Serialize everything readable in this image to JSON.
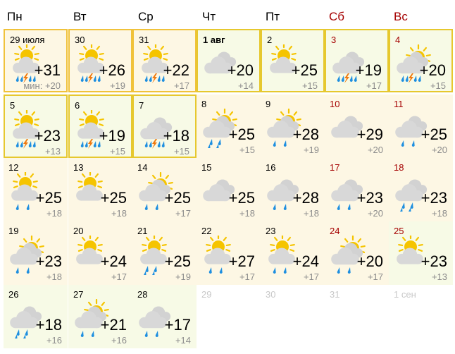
{
  "weekdays": [
    {
      "label": "Пн",
      "weekend": false
    },
    {
      "label": "Вт",
      "weekend": false
    },
    {
      "label": "Ср",
      "weekend": false
    },
    {
      "label": "Чт",
      "weekend": false
    },
    {
      "label": "Пт",
      "weekend": false
    },
    {
      "label": "Сб",
      "weekend": true
    },
    {
      "label": "Вс",
      "weekend": true
    }
  ],
  "min_prefix": "мин: ",
  "colors": {
    "weekend": "#a50000",
    "sun": "#f5c400",
    "cloud": "#d8d8d8",
    "rain": "#1e8fe0",
    "lightning": "#f07a10"
  },
  "days": [
    {
      "date": "29 июля",
      "weekend": false,
      "max": "+31",
      "min": "мин: +20",
      "icon": "sun-cloud-thunderstorm-icon"
    },
    {
      "date": "30",
      "weekend": false,
      "max": "+26",
      "min": "+19",
      "icon": "sun-cloud-thunderstorm-icon"
    },
    {
      "date": "31",
      "weekend": false,
      "max": "+22",
      "min": "+17",
      "icon": "sun-cloud-thunderstorm-icon"
    },
    {
      "date": "1 авг",
      "weekend": false,
      "bold": true,
      "max": "+20",
      "min": "+14",
      "icon": "overcast-icon"
    },
    {
      "date": "2",
      "weekend": false,
      "max": "+25",
      "min": "+15",
      "icon": "sun-cloud-icon"
    },
    {
      "date": "3",
      "weekend": true,
      "max": "+19",
      "min": "+17",
      "icon": "overcast-thunderstorm-icon"
    },
    {
      "date": "4",
      "weekend": true,
      "max": "+20",
      "min": "+15",
      "icon": "sun-overcast-thunderstorm-icon"
    },
    {
      "date": "5",
      "weekend": false,
      "max": "+23",
      "min": "+13",
      "icon": "sun-cloud-thunderstorm-icon"
    },
    {
      "date": "6",
      "weekend": false,
      "max": "+19",
      "min": "+15",
      "icon": "sun-cloud-thunderstorm-icon"
    },
    {
      "date": "7",
      "weekend": false,
      "max": "+18",
      "min": "+15",
      "icon": "overcast-thunderstorm-icon"
    },
    {
      "date": "8",
      "weekend": false,
      "max": "+25",
      "min": "+15",
      "icon": "sun-overcast-rain-icon"
    },
    {
      "date": "9",
      "weekend": false,
      "max": "+28",
      "min": "+19",
      "icon": "sun-overcast-light-rain-icon"
    },
    {
      "date": "10",
      "weekend": true,
      "max": "+29",
      "min": "+20",
      "icon": "overcast-icon"
    },
    {
      "date": "11",
      "weekend": true,
      "max": "+25",
      "min": "+20",
      "icon": "overcast-light-rain-icon"
    },
    {
      "date": "12",
      "weekend": false,
      "max": "+25",
      "min": "+18",
      "icon": "sun-cloud-light-rain-icon"
    },
    {
      "date": "13",
      "weekend": false,
      "max": "+25",
      "min": "+18",
      "icon": "sun-cloud-icon"
    },
    {
      "date": "14",
      "weekend": false,
      "max": "+25",
      "min": "+17",
      "icon": "sun-overcast-light-rain-icon"
    },
    {
      "date": "15",
      "weekend": false,
      "max": "+25",
      "min": "+18",
      "icon": "overcast-icon"
    },
    {
      "date": "16",
      "weekend": false,
      "max": "+28",
      "min": "+18",
      "icon": "overcast-light-rain-icon"
    },
    {
      "date": "17",
      "weekend": true,
      "max": "+23",
      "min": "+20",
      "icon": "overcast-light-rain-icon"
    },
    {
      "date": "18",
      "weekend": true,
      "max": "+23",
      "min": "+18",
      "icon": "overcast-rain-icon"
    },
    {
      "date": "19",
      "weekend": false,
      "max": "+23",
      "min": "+18",
      "icon": "sun-overcast-light-rain-icon"
    },
    {
      "date": "20",
      "weekend": false,
      "max": "+24",
      "min": "+17",
      "icon": "sun-cloud-icon"
    },
    {
      "date": "21",
      "weekend": false,
      "max": "+25",
      "min": "+19",
      "icon": "sun-cloud-rain-icon"
    },
    {
      "date": "22",
      "weekend": false,
      "max": "+27",
      "min": "+17",
      "icon": "sun-cloud-light-rain-icon"
    },
    {
      "date": "23",
      "weekend": false,
      "max": "+24",
      "min": "+17",
      "icon": "sun-cloud-light-rain-icon"
    },
    {
      "date": "24",
      "weekend": true,
      "max": "+20",
      "min": "+17",
      "icon": "sun-overcast-light-rain-icon"
    },
    {
      "date": "25",
      "weekend": true,
      "max": "+23",
      "min": "+13",
      "icon": "sun-cloud-icon"
    },
    {
      "date": "26",
      "weekend": false,
      "max": "+18",
      "min": "+16",
      "icon": "overcast-rain-icon"
    },
    {
      "date": "27",
      "weekend": false,
      "max": "+21",
      "min": "+16",
      "icon": "sun-overcast-light-rain-icon"
    },
    {
      "date": "28",
      "weekend": false,
      "max": "+17",
      "min": "+14",
      "icon": "overcast-light-rain-icon"
    },
    {
      "date": "29",
      "weekend": false,
      "muted": true
    },
    {
      "date": "30",
      "weekend": false,
      "muted": true
    },
    {
      "date": "31",
      "weekend": false,
      "muted": true
    },
    {
      "date": "1 сен",
      "weekend": false,
      "muted": true
    }
  ]
}
